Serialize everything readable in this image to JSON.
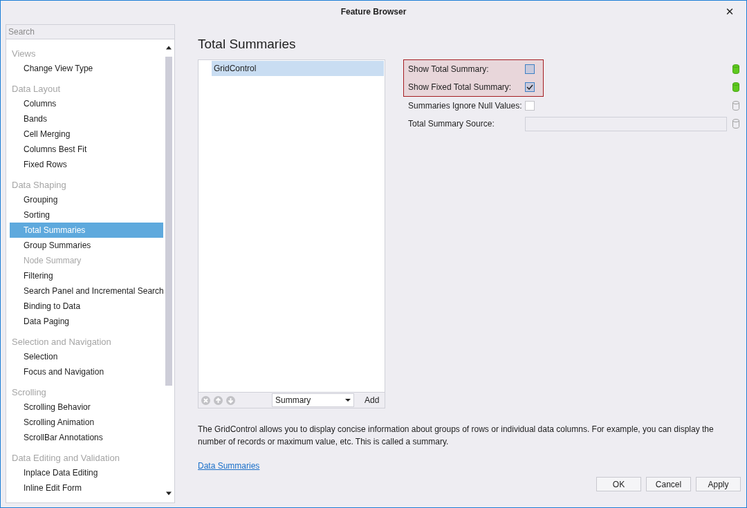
{
  "window": {
    "title": "Feature Browser",
    "close": "✕"
  },
  "sidebar": {
    "search": {
      "placeholder": "Search"
    },
    "groups": [
      {
        "heading": "Views",
        "items": [
          {
            "label": "Change View Type",
            "selected": false,
            "disabled": false
          }
        ]
      },
      {
        "heading": "Data Layout",
        "items": [
          {
            "label": "Columns",
            "selected": false,
            "disabled": false
          },
          {
            "label": "Bands",
            "selected": false,
            "disabled": false
          },
          {
            "label": "Cell Merging",
            "selected": false,
            "disabled": false
          },
          {
            "label": "Columns Best Fit",
            "selected": false,
            "disabled": false
          },
          {
            "label": "Fixed Rows",
            "selected": false,
            "disabled": false
          }
        ]
      },
      {
        "heading": "Data Shaping",
        "items": [
          {
            "label": "Grouping",
            "selected": false,
            "disabled": false
          },
          {
            "label": "Sorting",
            "selected": false,
            "disabled": false
          },
          {
            "label": "Total Summaries",
            "selected": true,
            "disabled": false
          },
          {
            "label": "Group Summaries",
            "selected": false,
            "disabled": false
          },
          {
            "label": "Node Summary",
            "selected": false,
            "disabled": true
          },
          {
            "label": "Filtering",
            "selected": false,
            "disabled": false
          },
          {
            "label": "Search Panel and Incremental Search",
            "selected": false,
            "disabled": false
          },
          {
            "label": "Binding to Data",
            "selected": false,
            "disabled": false
          },
          {
            "label": "Data Paging",
            "selected": false,
            "disabled": false
          }
        ]
      },
      {
        "heading": "Selection and Navigation",
        "items": [
          {
            "label": "Selection",
            "selected": false,
            "disabled": false
          },
          {
            "label": "Focus and Navigation",
            "selected": false,
            "disabled": false
          }
        ]
      },
      {
        "heading": "Scrolling",
        "items": [
          {
            "label": "Scrolling Behavior",
            "selected": false,
            "disabled": false
          },
          {
            "label": "Scrolling Animation",
            "selected": false,
            "disabled": false
          },
          {
            "label": "ScrollBar Annotations",
            "selected": false,
            "disabled": false
          }
        ]
      },
      {
        "heading": "Data Editing and Validation",
        "items": [
          {
            "label": "Inplace Data Editing",
            "selected": false,
            "disabled": false
          },
          {
            "label": "Inline Edit Form",
            "selected": false,
            "disabled": false
          }
        ]
      }
    ]
  },
  "main": {
    "title": "Total Summaries",
    "tree": {
      "items": [
        {
          "label": "GridControl",
          "selected": true
        }
      ],
      "dropdown": {
        "value": "Summary"
      },
      "add_button": "Add"
    },
    "properties": [
      {
        "label": "Show Total Summary:",
        "kind": "checkbox",
        "checked": false,
        "highlighted": true,
        "modified": true
      },
      {
        "label": "Show Fixed Total Summary:",
        "kind": "checkbox",
        "checked": true,
        "highlighted": true,
        "modified": true
      },
      {
        "label": "Summaries Ignore Null Values:",
        "kind": "checkbox",
        "checked": false,
        "highlighted": false,
        "modified": false
      },
      {
        "label": "Total Summary Source:",
        "kind": "text",
        "highlighted": false,
        "modified": false
      }
    ],
    "description": "The GridControl allows you to display concise information about groups of rows or individual data columns. For example, you can display the number of records or maximum value, etc. This is called a summary.",
    "link": "Data Summaries",
    "buttons": [
      "OK",
      "Cancel",
      "Apply"
    ]
  }
}
